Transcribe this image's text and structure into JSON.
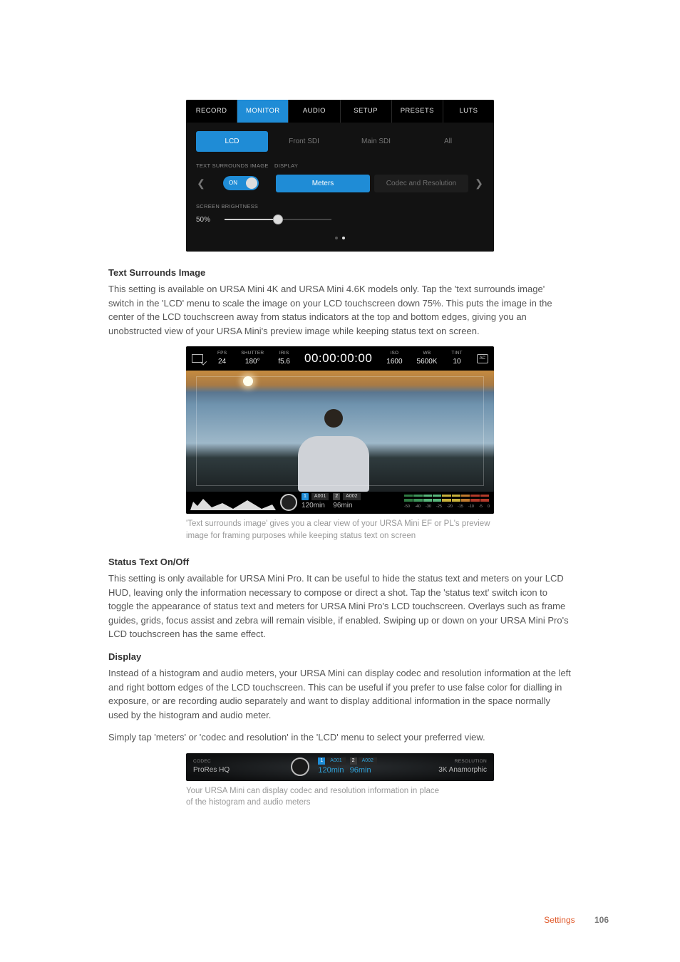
{
  "fig1": {
    "tabs": [
      "RECORD",
      "MONITOR",
      "AUDIO",
      "SETUP",
      "PRESETS",
      "LUTS"
    ],
    "active_tab": 1,
    "subtabs": [
      "LCD",
      "Front SDI",
      "Main SDI",
      "All"
    ],
    "active_subtab": 0,
    "label_text_surrounds": "TEXT SURROUNDS IMAGE",
    "label_display": "DISPLAY",
    "toggle_label": "ON",
    "seg_meters": "Meters",
    "seg_codec": "Codec and Resolution",
    "label_brightness": "SCREEN BRIGHTNESS",
    "brightness_value": "50%"
  },
  "section1": {
    "heading": "Text Surrounds Image",
    "body": "This setting is available on URSA Mini 4K and URSA Mini 4.6K models only. Tap the 'text surrounds image' switch in the 'LCD' menu to scale the image on your LCD touchscreen down 75%. This puts the image in the center of the LCD touchscreen away from status indicators at the top and bottom edges, giving you an unobstructed view of your URSA Mini's preview image while keeping status text on screen."
  },
  "hud": {
    "fps_label": "FPS",
    "fps": "24",
    "shutter_label": "SHUTTER",
    "shutter": "180°",
    "iris_label": "IRIS",
    "iris": "f5.6",
    "timecode": "00:00:00:00",
    "iso_label": "ISO",
    "iso": "1600",
    "wb_label": "WB",
    "wb": "5600K",
    "tint_label": "TINT",
    "tint": "10",
    "batt": "AC",
    "card1_num": "1",
    "card1_name": "A001",
    "card1_time": "120min",
    "card2_num": "2",
    "card2_name": "A002",
    "card2_time": "96min",
    "scale": [
      "-50",
      "-40",
      "-30",
      "-25",
      "-20",
      "-15",
      "-10",
      "-5",
      "0"
    ]
  },
  "caption1": "'Text surrounds image' gives you a clear view of your URSA Mini EF or PL's preview image for framing purposes while keeping status text on screen",
  "section2": {
    "heading": "Status Text On/Off",
    "body": "This setting is only available for URSA Mini Pro. It can be useful to hide the status text and meters on your LCD HUD, leaving only the information necessary to compose or direct a shot. Tap the 'status text' switch icon to toggle the appearance of status text and meters for URSA Mini Pro's LCD touchscreen. Overlays such as frame guides, grids, focus assist and zebra will remain visible, if enabled. Swiping up or down on your URSA Mini Pro's LCD touchscreen has the same effect."
  },
  "section3": {
    "heading": "Display",
    "body1": "Instead of a histogram and audio meters, your URSA Mini can display codec and resolution information at the left and right bottom edges of the LCD touchscreen. This can be useful if you prefer to use false color for dialling in exposure, or are recording audio separately and want to display additional information in the space normally used by the histogram and audio meter.",
    "body2": "Simply tap 'meters' or 'codec and resolution' in the 'LCD' menu to select your preferred view."
  },
  "fig3": {
    "codec_label": "CODEC",
    "codec": "ProRes HQ",
    "card1_num": "1",
    "card1_name": "A001",
    "card1_time": "120min",
    "card2_num": "2",
    "card2_name": "A002",
    "card2_time": "96min",
    "res_label": "RESOLUTION",
    "res": "3K Anamorphic"
  },
  "caption2": "Your URSA Mini can display codec and resolution information in place of the histogram and audio meters",
  "footer": {
    "section": "Settings",
    "page": "106"
  }
}
